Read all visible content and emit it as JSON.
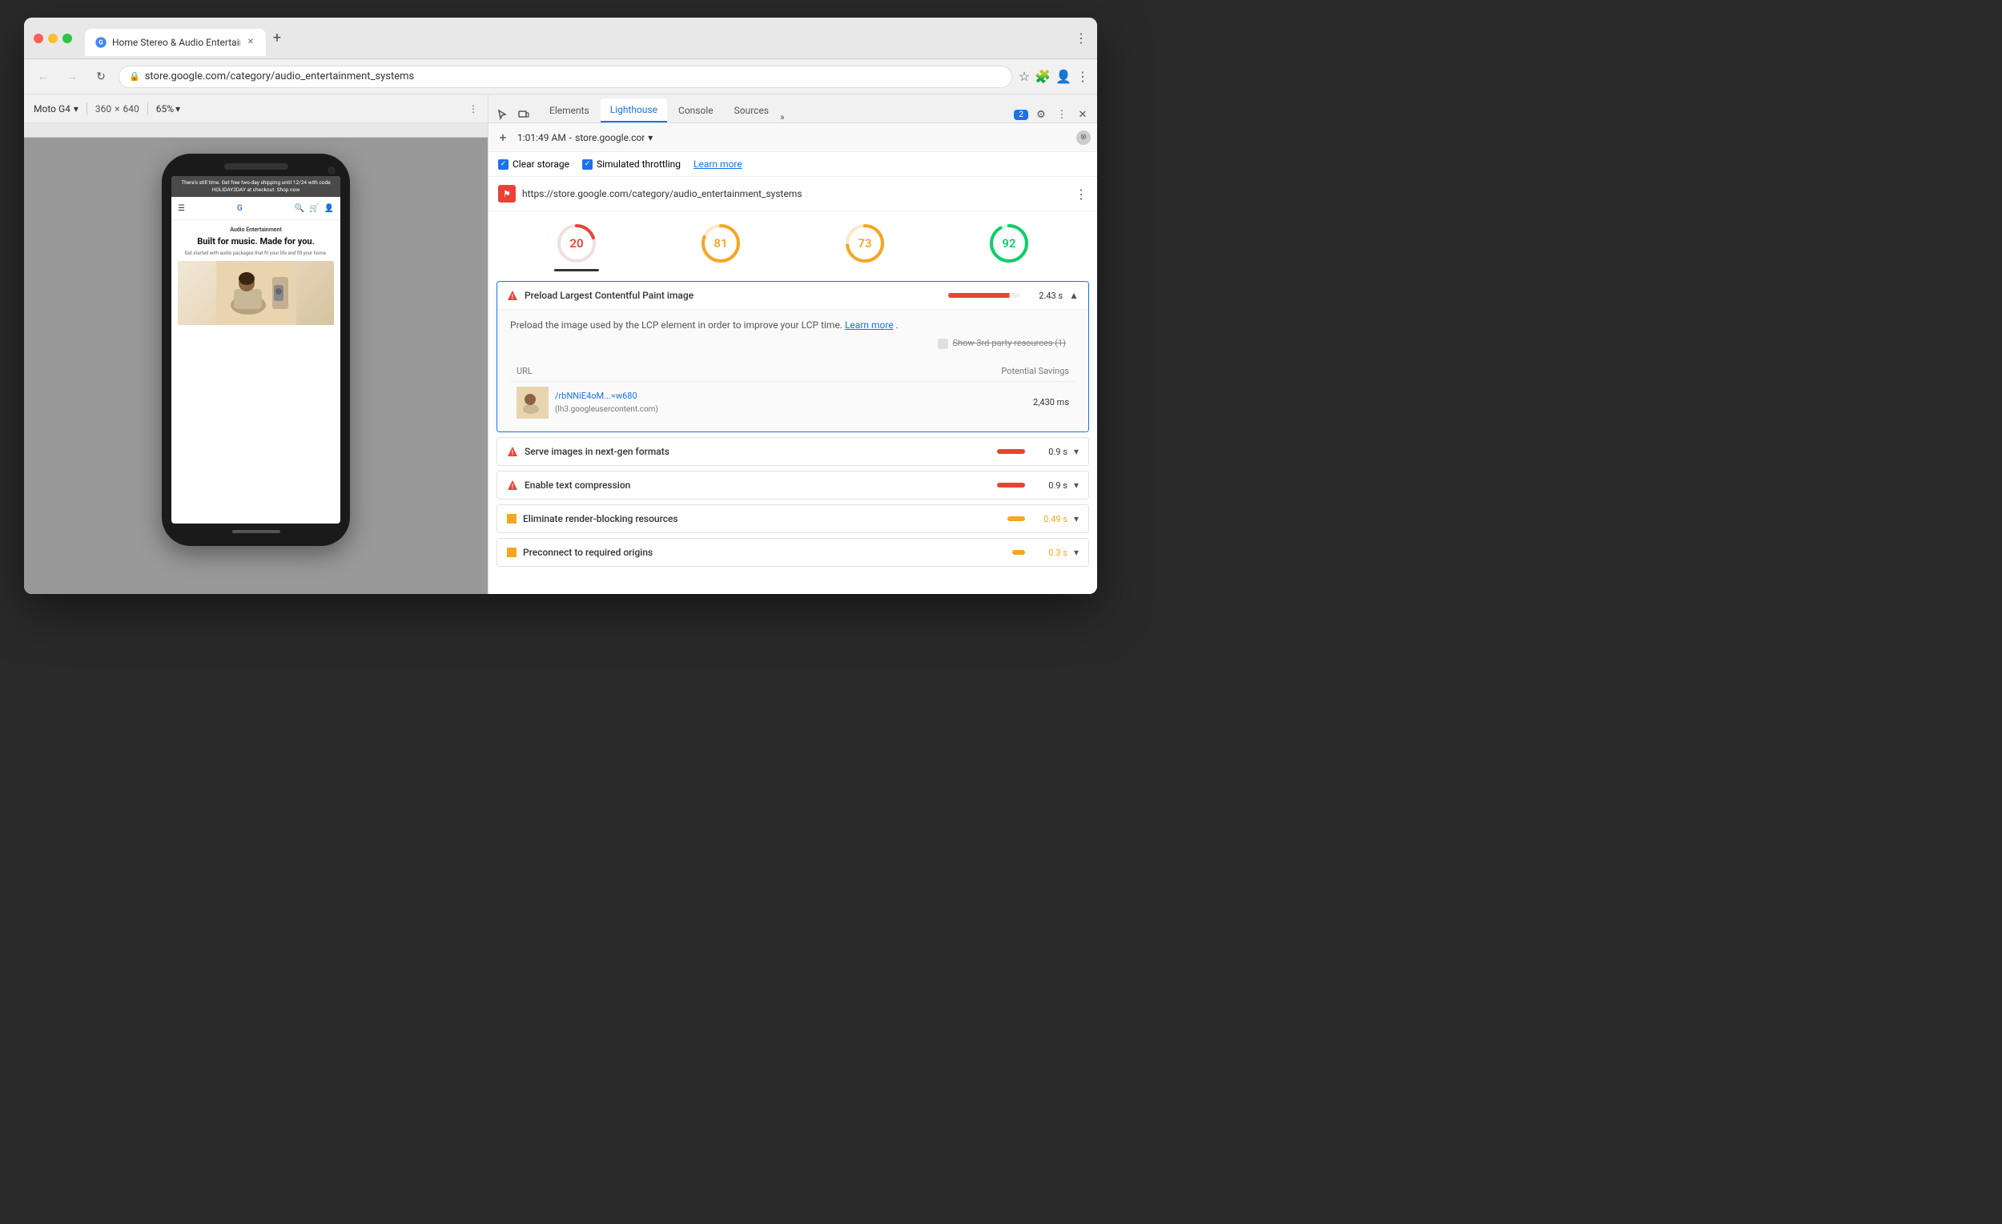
{
  "browser": {
    "tab_title": "Home Stereo & Audio Entertain...",
    "url": "store.google.com/category/audio_entertainment_systems",
    "full_url": "https://store.google.com/category/audio_entertainment_systems",
    "new_tab_label": "+"
  },
  "device_toolbar": {
    "device_name": "Moto G4",
    "width": "360",
    "x": "×",
    "height": "640",
    "zoom": "65%",
    "dots": "⋮"
  },
  "phone_content": {
    "banner": "There's still time. Get free two-day shipping until 12/24 with code HOLIDAY2DAY at checkout. Shop now",
    "section_title": "Audio Entertainment",
    "hero_title": "Built for music. Made for you.",
    "hero_sub": "Get started with audio packages that fit your life and fill your home."
  },
  "devtools": {
    "tabs": [
      "Elements",
      "Lighthouse",
      "Console",
      "Sources"
    ],
    "active_tab": "Lighthouse",
    "notification_count": "2"
  },
  "lighthouse": {
    "toolbar": {
      "add_label": "+",
      "time": "1:01:49 AM",
      "url_short": "store.google.cor",
      "dropdown_arrow": "▾"
    },
    "options": {
      "clear_storage_label": "Clear storage",
      "throttling_label": "Simulated throttling",
      "learn_more_label": "Learn more"
    },
    "audit_url": "https://store.google.com/category/audio_entertainment_systems",
    "scores": [
      {
        "value": 20,
        "color": "#ea4335",
        "stroke_dasharray": "56.5",
        "stroke_dashoffset": "45.2",
        "label": ""
      },
      {
        "value": 81,
        "color": "#f5a623",
        "stroke_dasharray": "56.5",
        "stroke_dashoffset": "10.7",
        "label": ""
      },
      {
        "value": 73,
        "color": "#f5a623",
        "stroke_dasharray": "56.5",
        "stroke_dashoffset": "15.3",
        "label": ""
      },
      {
        "value": 92,
        "color": "#0cce6b",
        "stroke_dasharray": "56.5",
        "stroke_dashoffset": "4.5",
        "label": ""
      }
    ],
    "score_values": [
      "20",
      "81",
      "73",
      "92"
    ],
    "score_colors": [
      "#ea4335",
      "#f5a623",
      "#f5a623",
      "#0cce6b"
    ],
    "active_score_index": 0,
    "audits": {
      "expanded": {
        "title": "Preload Largest Contentful Paint image",
        "time": "2.43 s",
        "description": "Preload the image used by the LCP element in order to improve your LCP time.",
        "learn_more": "Learn more",
        "show_3rd_party": "Show 3rd-party resources (1)",
        "table": {
          "headers": [
            "URL",
            "Potential Savings"
          ],
          "row": {
            "url": "/rbNNiE4oM...=w680",
            "domain": "(lh3.googleusercontent.com)",
            "savings": "2,430 ms"
          }
        }
      },
      "collapsed": [
        {
          "title": "Serve images in next-gen formats",
          "time": "0.9 s",
          "type": "red"
        },
        {
          "title": "Enable text compression",
          "time": "0.9 s",
          "type": "red"
        },
        {
          "title": "Eliminate render-blocking resources",
          "time": "0.49 s",
          "type": "orange"
        },
        {
          "title": "Preconnect to required origins",
          "time": "0.3 s",
          "type": "orange"
        }
      ]
    }
  }
}
